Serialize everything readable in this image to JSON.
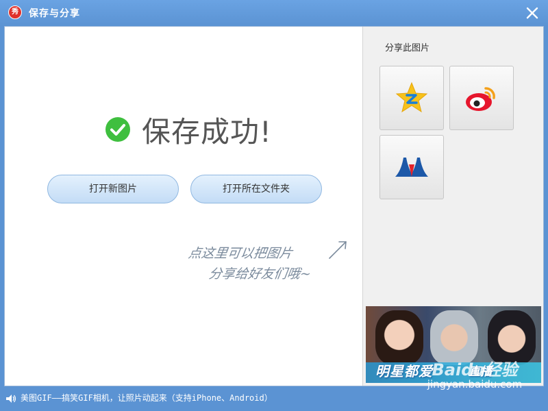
{
  "window": {
    "title": "保存与分享",
    "app_logo_text": "秀"
  },
  "main": {
    "success_message": "保存成功!",
    "buttons": {
      "open_new": "打开新图片",
      "open_folder": "打开所在文件夹"
    },
    "hint": {
      "line1": "点这里可以把图片",
      "line2": "分享给好友们哦~"
    }
  },
  "share": {
    "title": "分享此图片",
    "targets": [
      {
        "name": "QQ空间",
        "icon": "qzone-icon"
      },
      {
        "name": "新浪微博",
        "icon": "weibo-icon"
      },
      {
        "name": "人人网",
        "icon": "renren-icon"
      }
    ]
  },
  "ad": {
    "headline": "明星都爱",
    "live": "直播"
  },
  "statusbar": {
    "text": "美图GIF——搞笑GIF相机，让照片动起来（支持iPhone、Android）"
  },
  "watermark": {
    "logo": "Baidu经验",
    "url": "jingyan.baidu.com"
  },
  "colors": {
    "titlebar": "#5b93d3",
    "success_green": "#3fbf3f",
    "button_fill": "#cfe4fa"
  }
}
